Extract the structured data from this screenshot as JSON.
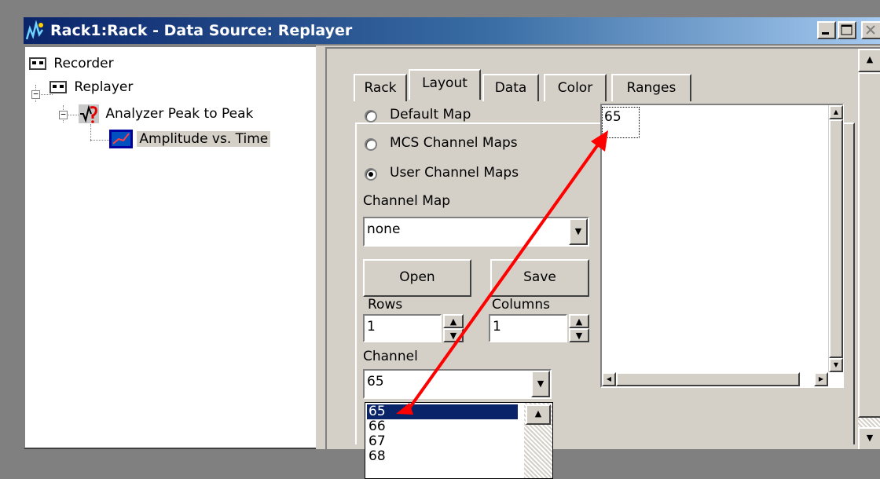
{
  "window": {
    "title": "Rack1:Rack - Data Source: Replayer",
    "controls": {
      "minimize": "minimize",
      "maximize": "maximize",
      "close": "close"
    }
  },
  "tree": {
    "items": [
      {
        "label": "Recorder",
        "icon": "recorder-icon"
      },
      {
        "label": "Replayer",
        "icon": "replayer-icon"
      },
      {
        "label": "Analyzer Peak to Peak",
        "icon": "analyzer-icon"
      },
      {
        "label": "Amplitude vs. Time",
        "icon": "display-icon",
        "selected": true
      }
    ]
  },
  "tabs": [
    {
      "label": "Rack"
    },
    {
      "label": "Layout",
      "active": true
    },
    {
      "label": "Data"
    },
    {
      "label": "Color"
    },
    {
      "label": "Ranges"
    }
  ],
  "layout": {
    "map_options": [
      {
        "label": "Default Map",
        "checked": false
      },
      {
        "label": "MCS Channel Maps",
        "checked": false
      },
      {
        "label": "User Channel Maps",
        "checked": true
      }
    ],
    "channel_map": {
      "label": "Channel Map",
      "value": "none"
    },
    "open_label": "Open",
    "save_label": "Save",
    "rows": {
      "label": "Rows",
      "value": "1"
    },
    "columns": {
      "label": "Columns",
      "value": "1"
    },
    "channel": {
      "label": "Channel",
      "value": "65",
      "options": [
        "65",
        "66",
        "67",
        "68"
      ],
      "selected_index": 0
    },
    "grid_cell": "65"
  },
  "annotation": {
    "arrow_color": "#ff0000"
  },
  "colors": {
    "titlebar_start": "#0a246a",
    "titlebar_end": "#a6caf0",
    "face": "#d4d0c8",
    "selection": "#0a246a"
  }
}
